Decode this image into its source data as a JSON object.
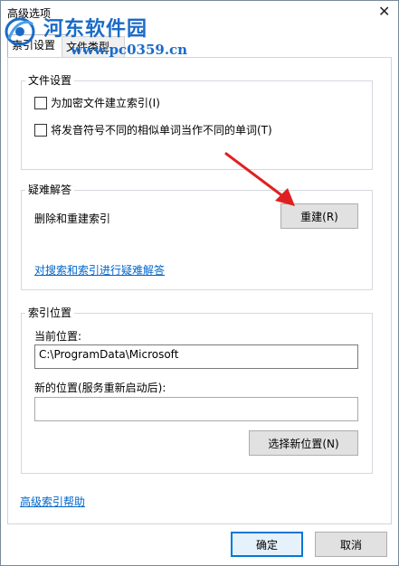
{
  "window": {
    "title": "高级选项",
    "close_glyph": "✕"
  },
  "watermark": {
    "name": "河东软件园",
    "url": "www.pc0359.cn"
  },
  "tabs": [
    {
      "label": "索引设置",
      "active": true
    },
    {
      "label": "文件类型",
      "active": false
    }
  ],
  "file_settings": {
    "legend": "文件设置",
    "options": [
      {
        "label": "为加密文件建立索引(I)",
        "checked": false
      },
      {
        "label": "将发音符号不同的相似单词当作不同的单词(T)",
        "checked": false
      }
    ]
  },
  "troubleshoot": {
    "legend": "疑难解答",
    "description": "删除和重建索引",
    "rebuild_button": "重建(R)",
    "link": "对搜索和索引进行疑难解答"
  },
  "index_location": {
    "legend": "索引位置",
    "current_label": "当前位置:",
    "current_value": "C:\\ProgramData\\Microsoft",
    "new_label": "新的位置(服务重新启动后):",
    "new_value": "",
    "select_button": "选择新位置(N)"
  },
  "help_link": "高级索引帮助",
  "footer": {
    "ok_button": "确定",
    "cancel_button": "取消"
  },
  "colors": {
    "link": "#0066cc",
    "arrow": "#e02020",
    "watermark": "#1a6bc8"
  }
}
